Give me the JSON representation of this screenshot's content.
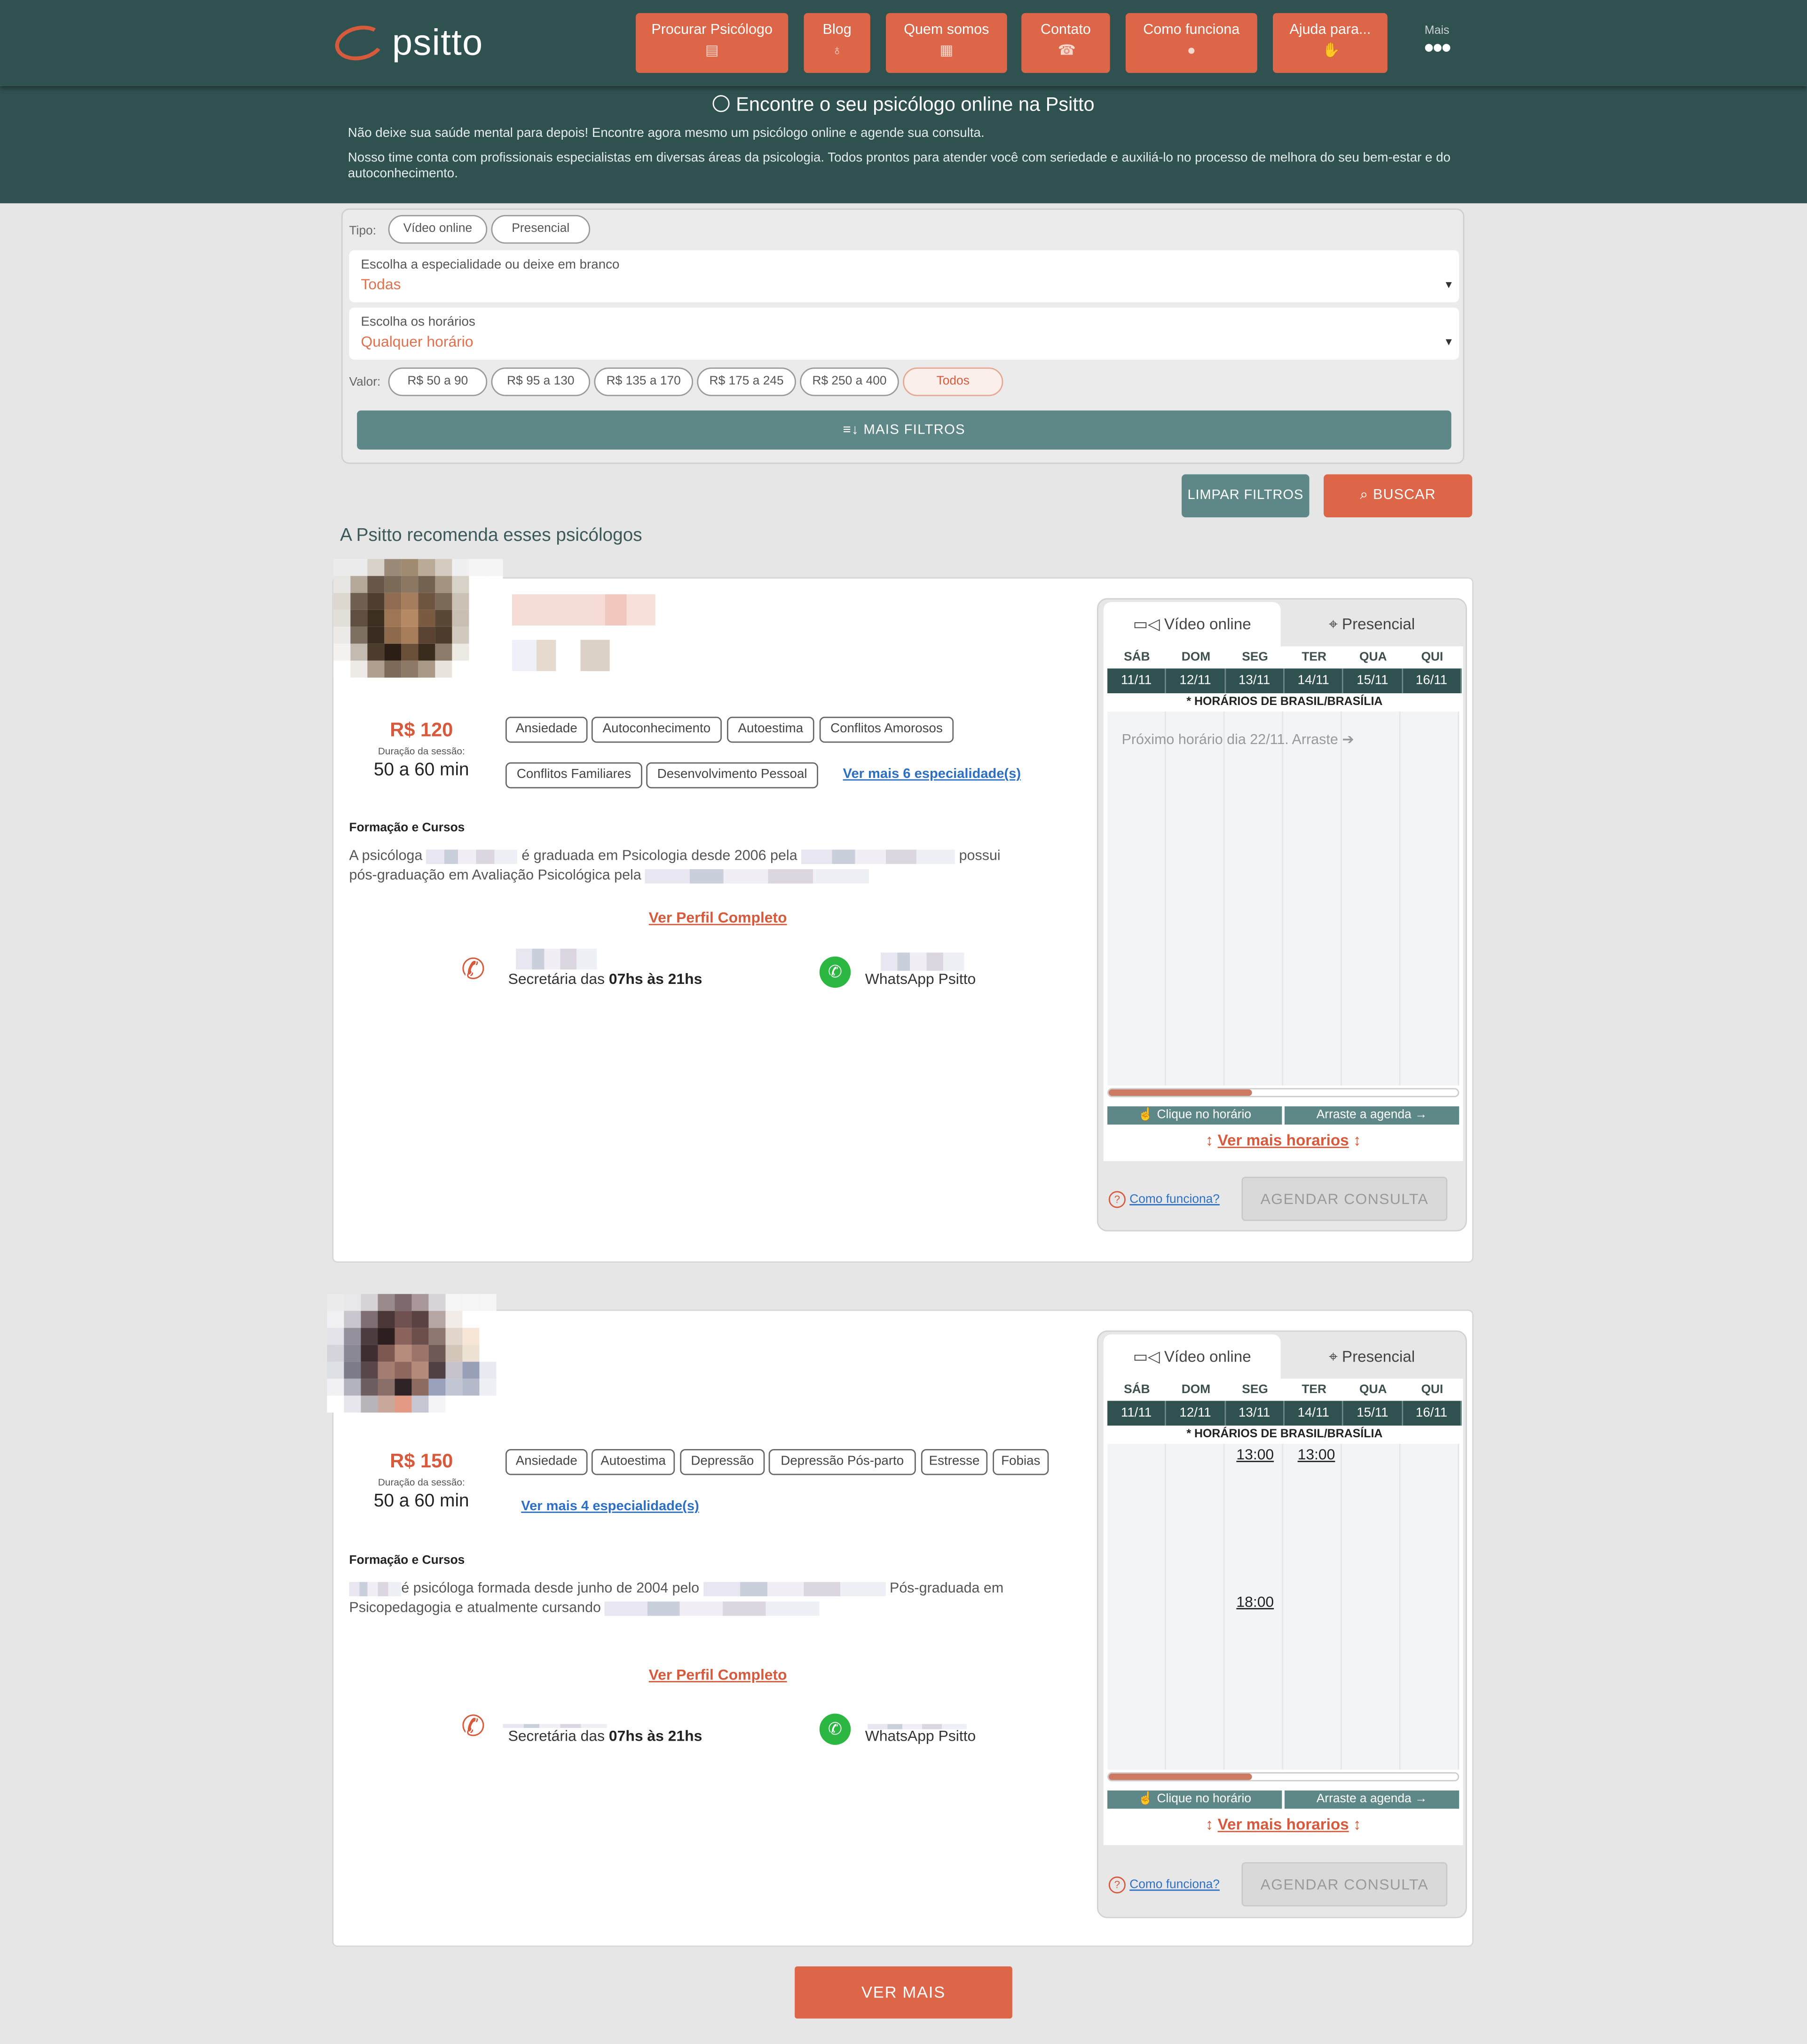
{
  "brand": {
    "name": "psitto"
  },
  "nav": {
    "items": [
      {
        "label": "Procurar Psicólogo",
        "icon": "document-icon"
      },
      {
        "label": "Blog",
        "icon": "lightbulb-icon"
      },
      {
        "label": "Quem somos",
        "icon": "building-icon"
      },
      {
        "label": "Contato",
        "icon": "phone-icon"
      },
      {
        "label": "Como funciona",
        "icon": "info-icon"
      },
      {
        "label": "Ajuda para...",
        "icon": "handshake-icon"
      }
    ],
    "more_label": "Mais"
  },
  "hero": {
    "title": "Encontre o seu psicólogo online na Psitto",
    "line1": "Não deixe sua saúde mental para depois! Encontre agora mesmo um psicólogo online e agende sua consulta.",
    "line2": "Nosso time conta com profissionais especialistas em diversas áreas da psicologia. Todos prontos para atender você com seriedade e auxiliá-lo no processo de melhora do seu bem-estar e do autoconhecimento."
  },
  "filters": {
    "tipo_label": "Tipo:",
    "tipo_options": [
      "Vídeo online",
      "Presencial"
    ],
    "especialidade": {
      "label": "Escolha a especialidade ou deixe em branco",
      "value": "Todas"
    },
    "horarios": {
      "label": "Escolha os horários",
      "value": "Qualquer horário"
    },
    "valor_label": "Valor:",
    "valor_options": [
      "R$   50 a 90",
      "R$   95 a 130",
      "R$   135 a 170",
      "R$   175 a 245",
      "R$   250 a 400",
      "Todos"
    ],
    "valor_selected": "Todos",
    "more_filters": "MAIS FILTROS",
    "clear": "LIMPAR FILTROS",
    "search": "BUSCAR"
  },
  "section_title": "A Psitto recomenda esses psicólogos",
  "cards": [
    {
      "price": "R$ 120",
      "duration_label": "Duração da sessão:",
      "duration": "50 a 60 min",
      "tags": [
        "Ansiedade",
        "Autoconhecimento",
        "Autoestima",
        "Conflitos Amorosos",
        "Conflitos Familiares",
        "Desenvolvimento Pessoal"
      ],
      "see_more": "Ver mais 6 especialidade(s)",
      "formacao_label": "Formação e Cursos",
      "bio": {
        "a": "A psicóloga",
        "b": "é graduada em Psicologia desde 2006 pela",
        "c": "possui",
        "d": "pós-graduação em Avaliação Psicológica pela"
      },
      "profile_link": "Ver Perfil Completo",
      "secretaria_prefix": "Secretária das",
      "secretaria_hours": "07hs às 21hs",
      "whatsapp": "WhatsApp Psitto",
      "schedule": {
        "tabs": [
          "Vídeo online",
          "Presencial"
        ],
        "days": [
          "SÁB",
          "DOM",
          "SEG",
          "TER",
          "QUA",
          "QUI"
        ],
        "dates": [
          "11/11",
          "12/11",
          "13/11",
          "14/11",
          "15/11",
          "16/11"
        ],
        "timezone": "* HORÁRIOS DE BRASIL/BRASÍLIA",
        "next_slot": "Próximo horário dia 22/11. Arraste",
        "slots": [],
        "scroll_position": 0.41,
        "hint_click": "Clique no horário",
        "hint_drag": "Arraste a agenda",
        "see_more_hours": "Ver mais horarios",
        "how": "Como funciona?",
        "book": "AGENDAR CONSULTA"
      }
    },
    {
      "price": "R$ 150",
      "duration_label": "Duração da sessão:",
      "duration": "50 a 60 min",
      "tags": [
        "Ansiedade",
        "Autoestima",
        "Depressão",
        "Depressão Pós-parto",
        "Estresse",
        "Fobias"
      ],
      "see_more": "Ver mais 4 especialidade(s)",
      "formacao_label": "Formação e Cursos",
      "bio": {
        "a": "é psicóloga formada desde junho de 2004 pelo",
        "b": "Pós-graduada em",
        "c": "Psicopedagogia e atualmente cursando"
      },
      "profile_link": "Ver Perfil Completo",
      "secretaria_prefix": "Secretária das",
      "secretaria_hours": "07hs às 21hs",
      "whatsapp": "WhatsApp Psitto",
      "schedule": {
        "tabs": [
          "Vídeo online",
          "Presencial"
        ],
        "days": [
          "SÁB",
          "DOM",
          "SEG",
          "TER",
          "QUA",
          "QUI"
        ],
        "dates": [
          "11/11",
          "12/11",
          "13/11",
          "14/11",
          "15/11",
          "16/11"
        ],
        "timezone": "* HORÁRIOS DE BRASIL/BRASÍLIA",
        "slots": [
          {
            "day": "SEG",
            "time": "13:00"
          },
          {
            "day": "TER",
            "time": "13:00"
          },
          {
            "day": "SEG",
            "time": "18:00"
          }
        ],
        "scroll_position": 0.41,
        "hint_click": "Clique no horário",
        "hint_drag": "Arraste a agenda",
        "see_more_hours": "Ver mais horarios",
        "how": "Como funciona?",
        "book": "AGENDAR CONSULTA"
      }
    }
  ],
  "see_more": "VER MAIS",
  "colors": {
    "header": "#2f5150",
    "accent": "#dd6648",
    "teal_button": "#5e8888"
  }
}
